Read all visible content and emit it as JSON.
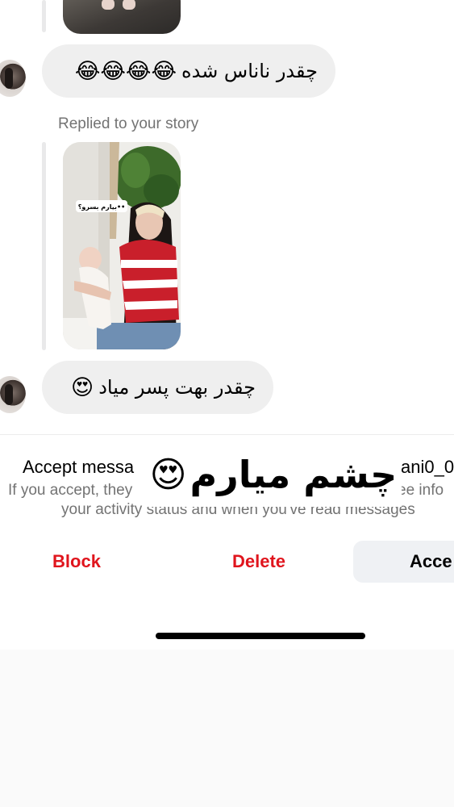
{
  "conversation": {
    "messages": [
      {
        "text": "چقدر ناناس شده",
        "emoji": "😂😂😂😂"
      },
      {
        "text": "چقدر بهت پسر میاد",
        "emoji": "😍"
      }
    ],
    "replied_label": "Replied to your story",
    "story_sticker_text": "بیارم بسرو؟••"
  },
  "request_panel": {
    "title_visible": "Accept messa",
    "username_visible": "ani0_0",
    "desc_line1_left": "If you accept, they",
    "desc_line1_right": "ee info",
    "desc_line2": "your activity status and when you've read messages"
  },
  "overlay": {
    "text": "چشم میارم",
    "emoji": "😍"
  },
  "actions": {
    "block_label": "Block",
    "delete_label": "Delete",
    "accept_label": "Acce"
  },
  "colors": {
    "danger": "#e0151d",
    "bubble_bg": "#efefef",
    "secondary_text": "#737373",
    "accept_bg": "#eff1f4"
  }
}
